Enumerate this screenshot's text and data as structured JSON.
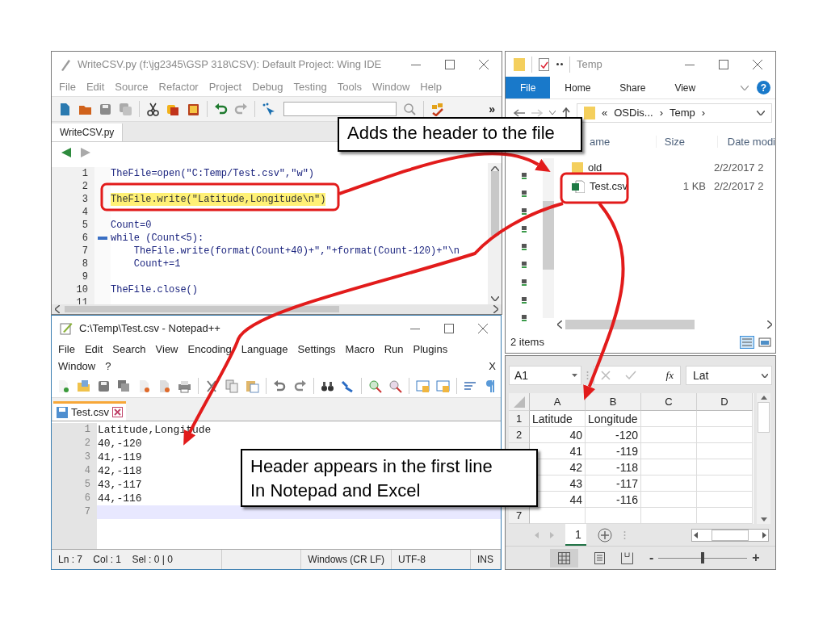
{
  "wing_ide": {
    "title": "WriteCSV.py (f:\\jg2345\\GSP 318\\CSV): Default Project: Wing IDE",
    "menu": [
      "File",
      "Edit",
      "Source",
      "Refactor",
      "Project",
      "Debug",
      "Testing",
      "Tools",
      "Window",
      "Help"
    ],
    "overflow": "»",
    "tab": {
      "label": "WriteCSV.py",
      "selected": true
    },
    "code": [
      {
        "number": "1",
        "text": "TheFile=open(\"C:Temp/Test.csv\",\"w\")",
        "highlighted": false,
        "fold": false
      },
      {
        "number": "2",
        "highlighted": false,
        "fold": false
      },
      {
        "number": "3",
        "text": "TheFile.write(\"Latitude,Longitude\\n\")",
        "highlighted": true,
        "fold": false
      },
      {
        "number": "4",
        "highlighted": false,
        "fold": false
      },
      {
        "number": "5",
        "text": "Count=0",
        "highlighted": false,
        "fold": false
      },
      {
        "number": "6",
        "text": "while (Count<5):",
        "highlighted": false,
        "fold": true
      },
      {
        "number": "7",
        "text": "    TheFile.write(format(Count+40)+\",\"+format(Count-120)+\"\\n",
        "highlighted": false,
        "fold": false
      },
      {
        "number": "8",
        "text": "    Count+=1",
        "highlighted": false,
        "fold": false
      },
      {
        "number": "9",
        "highlighted": false,
        "fold": false
      },
      {
        "number": "10",
        "text": "TheFile.close()",
        "highlighted": false,
        "fold": false
      },
      {
        "number": "11",
        "highlighted": false,
        "fold": false
      }
    ]
  },
  "explorer": {
    "title": "Temp",
    "ribbon_tabs": [
      {
        "label": "File",
        "selected": true
      },
      {
        "label": "Home",
        "selected": false
      },
      {
        "label": "Share",
        "selected": false
      },
      {
        "label": "View",
        "selected": false
      }
    ],
    "help": "?",
    "address_parts": [
      "«",
      "OSDis...",
      "›",
      "Temp",
      "›"
    ],
    "columns": [
      "ame",
      "Size",
      "Date modi"
    ],
    "files": [
      {
        "kind": "folder",
        "name": "old",
        "date": "2/2/2017 2"
      },
      {
        "kind": "spreadsheet",
        "name": "Test.csv",
        "size": "1 KB",
        "date": "2/2/2017 2"
      }
    ],
    "status": "2 items"
  },
  "notepad": {
    "title": "C:\\Temp\\Test.csv - Notepad++",
    "menu_rows": [
      [
        "File",
        "Edit",
        "Search",
        "View",
        "Encoding",
        "Language",
        "Settings",
        "Macro",
        "Run",
        "Plugins"
      ],
      [
        "Window",
        "?"
      ]
    ],
    "close_document": "X",
    "tab": {
      "label": "Test.csv",
      "selected": true
    },
    "lines": [
      {
        "number": "1",
        "text": "Latitude,Longitude",
        "current": false
      },
      {
        "number": "2",
        "text": "40,-120",
        "current": false
      },
      {
        "number": "3",
        "text": "41,-119",
        "current": false
      },
      {
        "number": "4",
        "text": "42,-118",
        "current": false
      },
      {
        "number": "5",
        "text": "43,-117",
        "current": false
      },
      {
        "number": "6",
        "text": "44,-116",
        "current": false
      },
      {
        "number": "7",
        "current": true
      }
    ],
    "status": {
      "position": "Ln : 7    Col : 1    Sel : 0 | 0",
      "line_endings": "Windows (CR LF)",
      "encoding": "UTF-8",
      "mode": "INS"
    }
  },
  "excel": {
    "name_box": "A1",
    "function_label": "fx",
    "formula": "Lat",
    "columns": [
      "A",
      "B",
      "C",
      "D"
    ],
    "rows": [
      {
        "number": "1",
        "cells": [
          {
            "text": "Latitude",
            "kind": "text"
          },
          {
            "text": "Longitude",
            "kind": "text"
          }
        ]
      },
      {
        "number": "2",
        "cells": [
          {
            "text": "40",
            "kind": "number"
          },
          {
            "text": "-120",
            "kind": "number"
          }
        ]
      },
      {
        "cells": [
          {
            "text": "41",
            "kind": "number"
          },
          {
            "text": "-119",
            "kind": "number"
          }
        ]
      },
      {
        "cells": [
          {
            "text": "42",
            "kind": "number"
          },
          {
            "text": "-118",
            "kind": "number"
          }
        ]
      },
      {
        "cells": [
          {
            "text": "43",
            "kind": "number"
          },
          {
            "text": "-117",
            "kind": "number"
          }
        ]
      },
      {
        "cells": [
          {
            "text": "44",
            "kind": "number"
          },
          {
            "text": "-116",
            "kind": "number"
          }
        ]
      },
      {
        "number": "7",
        "cells": []
      }
    ],
    "sheet_tab": {
      "label": "1",
      "selected": true
    },
    "zoom": {
      "minus": "-",
      "plus": "+",
      "level": 0.5
    }
  },
  "callouts": [
    {
      "lines": [
        "Adds the header to the file"
      ]
    },
    {
      "lines": [
        "Header appears in the first line",
        "In Notepad and Excel"
      ]
    }
  ]
}
